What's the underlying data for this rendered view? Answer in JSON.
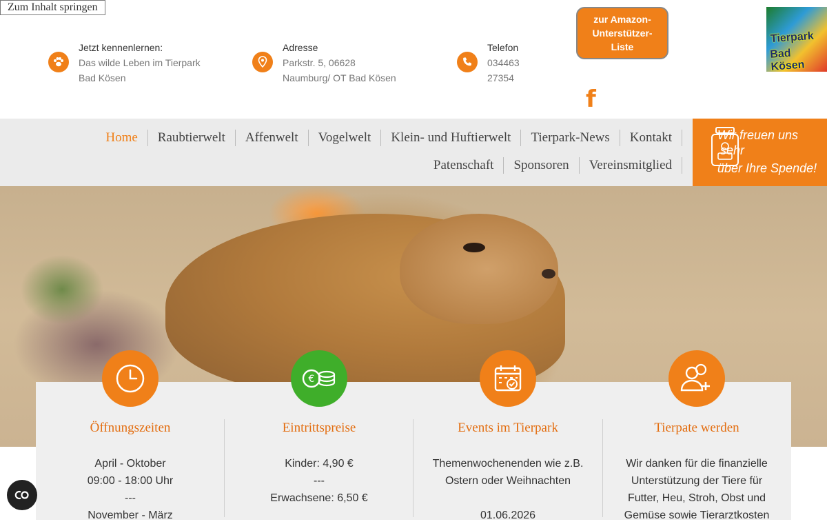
{
  "skip_link": "Zum Inhalt springen",
  "info": [
    {
      "heading": "Jetzt kennenlernen:",
      "line1": "Das wilde Leben im Tierpark",
      "line2": "Bad Kösen",
      "icon": "paw-icon"
    },
    {
      "heading": "Adresse",
      "line1": "Parkstr. 5, 06628",
      "line2": "Naumburg/ OT Bad Kösen",
      "icon": "location-pin-icon"
    },
    {
      "heading": "Telefon",
      "line1": "034463",
      "line2": "27354",
      "icon": "phone-icon"
    }
  ],
  "amazon_button": {
    "line1": "zur Amazon-",
    "line2": "Unterstützer-",
    "line3": "Liste"
  },
  "logo": {
    "line1": "Tierpark",
    "line2": "Bad Kösen"
  },
  "facebook_glyph": "f",
  "nav": {
    "row1": [
      "Home",
      "Raubtierwelt",
      "Affenwelt",
      "Vogelwelt",
      "Klein- und Huftierwelt",
      "Tierpark-News",
      "Kontakt"
    ],
    "row2": [
      "Patenschaft",
      "Sponsoren",
      "Vereinsmitglied"
    ]
  },
  "donate": {
    "line1": "freuen uns",
    "line1_prefix": "Wir",
    "line1_overlap": "sehr",
    "line2": "über Ihre Spende!"
  },
  "colors": {
    "accent": "#f08019",
    "green": "#3fae2a",
    "title": "#e36d0f"
  },
  "cards": [
    {
      "title": "Öffnungszeiten",
      "icon": "clock-icon",
      "lines": [
        "April - Oktober",
        "09:00 - 18:00 Uhr",
        "---",
        "November - März"
      ]
    },
    {
      "title": "Eintrittspreise",
      "icon": "coins-icon",
      "lines": [
        "Kinder: 4,90 €",
        "---",
        "Erwachsene: 6,50 €"
      ]
    },
    {
      "title": "Events im Tierpark",
      "icon": "calendar-check-icon",
      "lines": [
        "Themenwochenenden wie z.B.",
        "Ostern oder Weihnachten",
        "",
        "01.06.2026"
      ]
    },
    {
      "title": "Tierpate werden",
      "icon": "add-user-icon",
      "lines": [
        "Wir danken für die finanzielle",
        "Unterstützung der Tiere für",
        "Futter, Heu, Stroh, Obst und",
        "Gemüse sowie Tierarztkosten"
      ]
    }
  ]
}
